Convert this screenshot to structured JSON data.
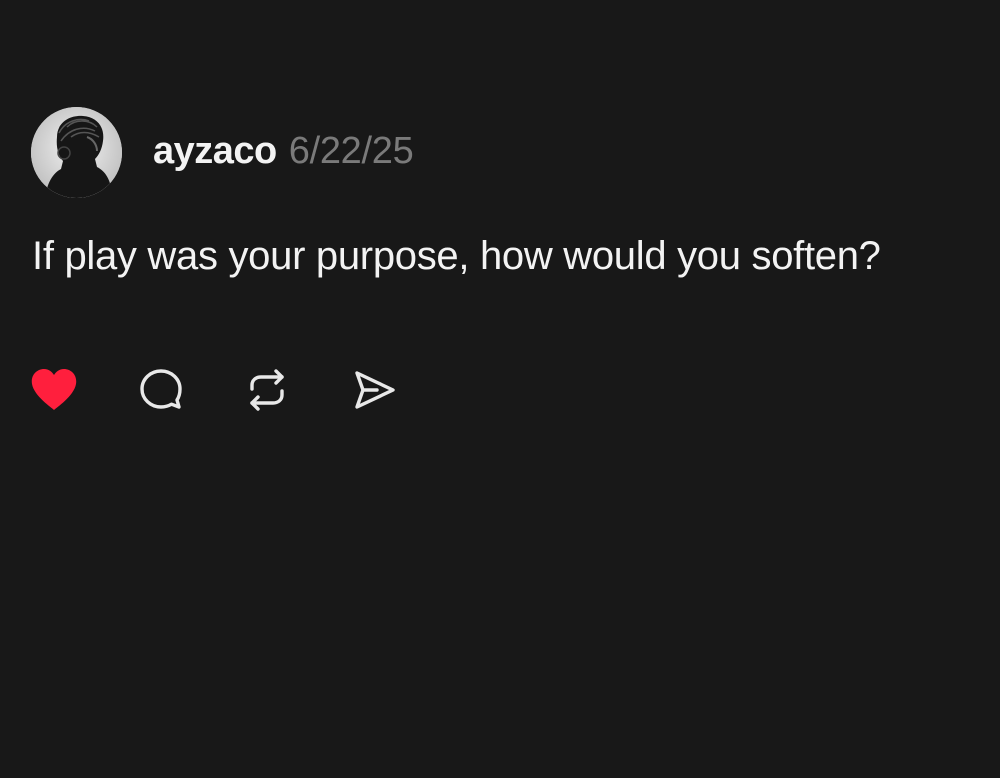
{
  "post": {
    "username": "ayzaco",
    "date": "6/22/25",
    "text": "If play was your purpose, how would you soften?"
  },
  "actions": [
    {
      "icon": "heart-icon",
      "state": "liked",
      "color": "#ff1f3d"
    },
    {
      "icon": "comment-icon",
      "color": "#e8e8e8"
    },
    {
      "icon": "repost-icon",
      "color": "#e8e8e8"
    },
    {
      "icon": "send-icon",
      "color": "#e8e8e8"
    }
  ],
  "colors": {
    "background": "#181818",
    "primary_text": "#f3f3f3",
    "secondary_text": "#7a7a7a",
    "like": "#ff1f3d"
  }
}
